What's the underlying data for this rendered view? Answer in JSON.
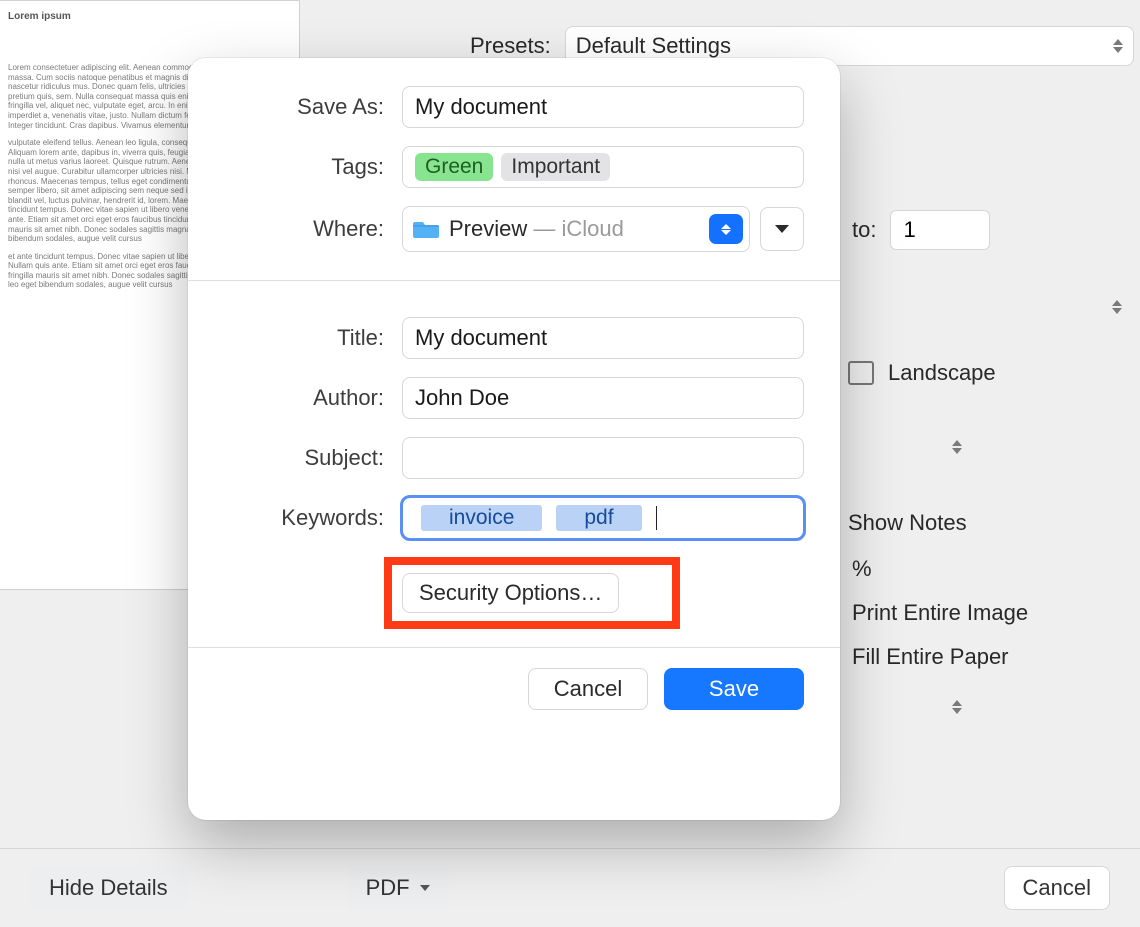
{
  "background": {
    "lorem_title": "Lorem ipsum",
    "lorem_para1": "Lorem consectetuer adipiscing elit. Aenean commodo ligula eget dolor. Aenean massa. Cum sociis natoque penatibus et magnis dis parturient montes, nascetur ridiculus mus. Donec quam felis, ultricies nec, pellentesque eu, pretium quis, sem. Nulla consequat massa quis enim. Donec pede justo, fringilla vel, aliquet nec, vulputate eget, arcu. In enim justo, rhoncus ut, imperdiet a, venenatis vitae, justo. Nullam dictum felis eu pede mollis pretium. Integer tincidunt. Cras dapibus. Vivamus elementum semper nisi. Aenean",
    "lorem_para2": "vulputate eleifend tellus. Aenean leo ligula, consequat vitae, eleifend ac, enim. Aliquam lorem ante, dapibus in, viverra quis, feugiat a, tellus. Phasellus viverra nulla ut metus varius laoreet. Quisque rutrum. Aenean imperdiet. Etiam ultricies nisi vel augue. Curabitur ullamcorper ultricies nisi. Nam eget dui. Etiam rhoncus. Maecenas tempus, tellus eget condimentum rhoncus, sem quam semper libero, sit amet adipiscing sem neque sed ipsum. Nam quam nunc, blandit vel, luctus pulvinar, hendrerit id, lorem. Maecenas nec odio et ante tincidunt tempus. Donec vitae sapien ut libero venenatis faucibus. Nullam quis ante. Etiam sit amet orci eget eros faucibus tincidunt. Duis leo. Sed fringilla mauris sit amet nibh. Donec sodales sagittis magna. Sed consequat, leo eget bibendum sodales, augue velit cursus",
    "lorem_para3": "et ante tincidunt tempus. Donec vitae sapien ut libero venenatis faucibus. Nullam quis ante. Etiam sit amet orci eget eros faucibus tincidunt. Duis leo. Sed fringilla mauris sit amet nibh. Donec sodales sagittis magna. Sed consequat, leo eget bibendum sodales, augue velit cursus",
    "presets_label": "Presets:",
    "presets_value": "Default Settings",
    "to_label": "to:",
    "to_value": "1",
    "landscape_label": "Landscape",
    "show_notes_label": "Show Notes",
    "scale_pct_suffix": " %",
    "scale_to_fit_opt1": "Print Entire Image",
    "scale_to_fit_opt2": "Fill Entire Paper",
    "hide_details_label": "Hide Details",
    "pdf_label": "PDF",
    "cancel_label": "Cancel"
  },
  "sheet": {
    "save_as_label": "Save As:",
    "save_as_value": "My document",
    "tags_label": "Tags:",
    "tags": [
      {
        "text": "Green",
        "style": "green"
      },
      {
        "text": "Important",
        "style": "grey"
      }
    ],
    "where_label": "Where:",
    "where_folder": "Preview",
    "where_separator": " — ",
    "where_cloud": "iCloud",
    "title_label": "Title:",
    "title_value": "My document",
    "author_label": "Author:",
    "author_value": "John Doe",
    "subject_label": "Subject:",
    "subject_value": "",
    "keywords_label": "Keywords:",
    "keywords": [
      "invoice",
      "pdf"
    ],
    "security_label": "Security Options…",
    "cancel_label": "Cancel",
    "save_label": "Save"
  }
}
